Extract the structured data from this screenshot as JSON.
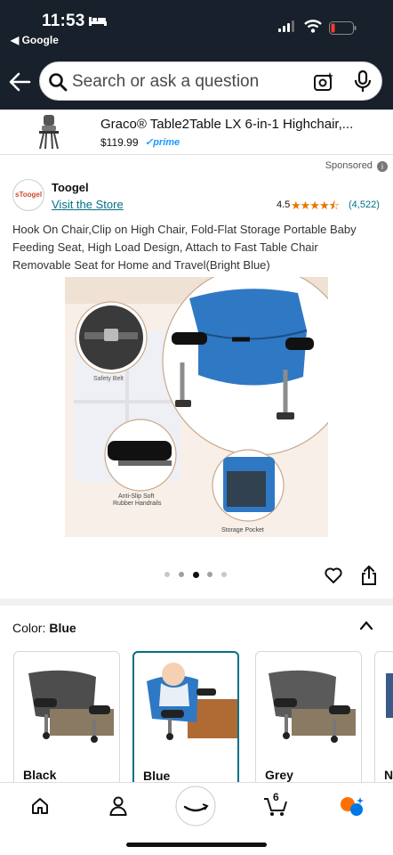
{
  "status": {
    "time": "11:53",
    "back_app": "◀ Google"
  },
  "search": {
    "placeholder": "Search or ask a question"
  },
  "ad": {
    "title": "Graco® Table2Table LX 6-in-1 Highchair,...",
    "price": "$119.99",
    "prime": "✓prime"
  },
  "sponsored": "Sponsored",
  "store": {
    "logo_text": "sToogel",
    "brand": "Toogel",
    "link": "Visit the Store",
    "rating": "4.5",
    "reviews": "(4,522)",
    "stars": "★★★★⯪"
  },
  "product": {
    "description": "Hook On Chair,Clip on High Chair, Fold-Flat Storage Portable Baby Feeding Seat, High Load Design, Attach to Fast Table Chair Removable Seat for Home and Travel(Bright Blue)",
    "callouts": {
      "belt": "Safety Belt",
      "handrails_1": "Anti-Slip Soft",
      "handrails_2": "Rubber Handrails",
      "pocket": "Storage Pocket"
    },
    "image_index": 3,
    "image_count": 5
  },
  "color": {
    "label": "Color:",
    "selected": "Blue",
    "options": [
      "Black",
      "Blue",
      "Grey",
      "N"
    ]
  },
  "nav": {
    "cart_count": "6"
  },
  "colors": {
    "accent": "#007185",
    "header": "#17202b",
    "star": "#e77600",
    "notification": "#ff6f00"
  }
}
